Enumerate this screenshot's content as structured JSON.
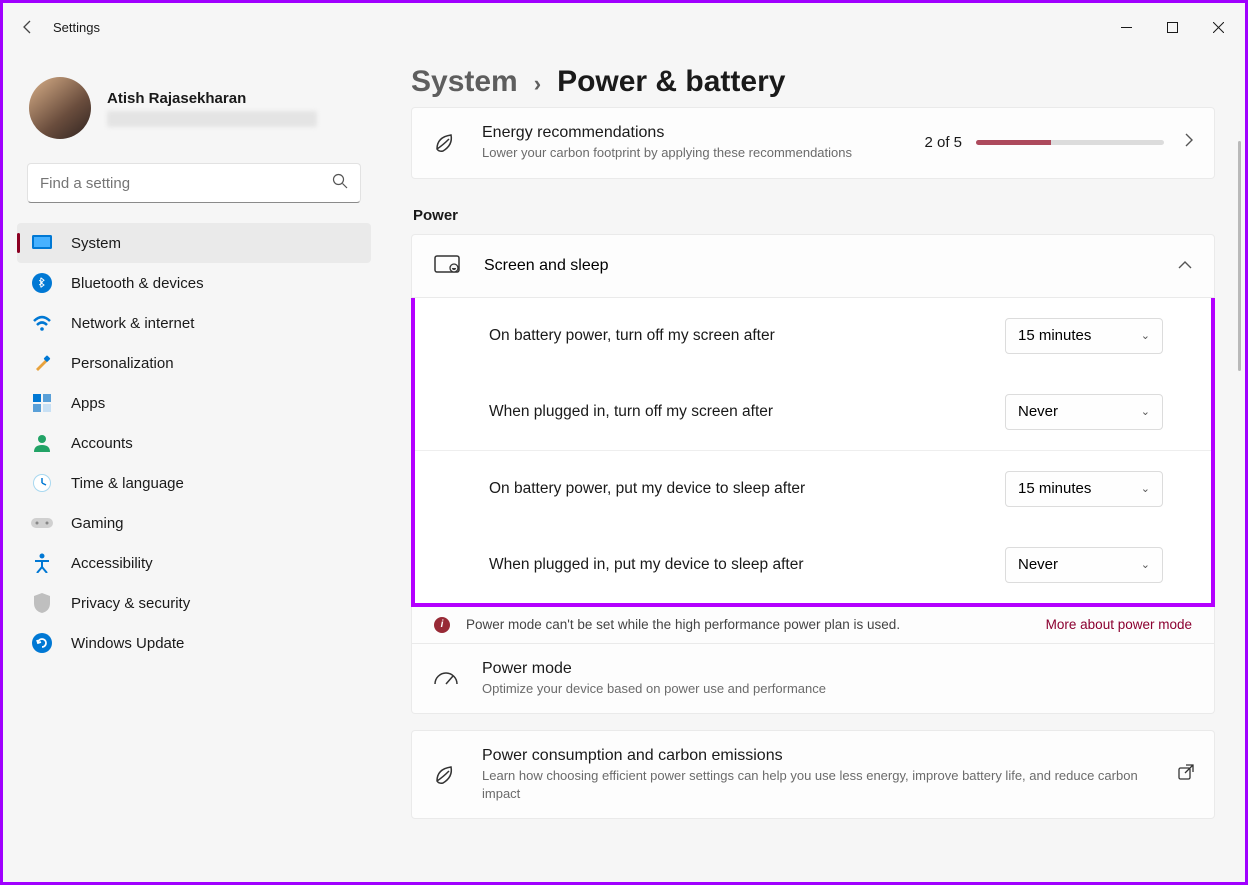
{
  "titlebar": {
    "title": "Settings"
  },
  "profile": {
    "name": "Atish Rajasekharan"
  },
  "search": {
    "placeholder": "Find a setting"
  },
  "nav": {
    "items": [
      {
        "label": "System",
        "active": true
      },
      {
        "label": "Bluetooth & devices"
      },
      {
        "label": "Network & internet"
      },
      {
        "label": "Personalization"
      },
      {
        "label": "Apps"
      },
      {
        "label": "Accounts"
      },
      {
        "label": "Time & language"
      },
      {
        "label": "Gaming"
      },
      {
        "label": "Accessibility"
      },
      {
        "label": "Privacy & security"
      },
      {
        "label": "Windows Update"
      }
    ]
  },
  "breadcrumb": {
    "parent": "System",
    "current": "Power & battery"
  },
  "energy": {
    "title": "Energy recommendations",
    "subtitle": "Lower your carbon footprint by applying these recommendations",
    "count": "2 of 5",
    "progress_pct": 40
  },
  "section_power": "Power",
  "screen_sleep": {
    "title": "Screen and sleep"
  },
  "settings": {
    "battery_screen_label": "On battery power, turn off my screen after",
    "battery_screen_value": "15 minutes",
    "plugged_screen_label": "When plugged in, turn off my screen after",
    "plugged_screen_value": "Never",
    "battery_sleep_label": "On battery power, put my device to sleep after",
    "battery_sleep_value": "15 minutes",
    "plugged_sleep_label": "When plugged in, put my device to sleep after",
    "plugged_sleep_value": "Never"
  },
  "notice": {
    "text": "Power mode can't be set while the high performance power plan is used.",
    "link": "More about power mode"
  },
  "power_mode": {
    "title": "Power mode",
    "subtitle": "Optimize your device based on power use and performance"
  },
  "carbon": {
    "title": "Power consumption and carbon emissions",
    "subtitle": "Learn how choosing efficient power settings can help you use less energy, improve battery life, and reduce carbon impact"
  }
}
